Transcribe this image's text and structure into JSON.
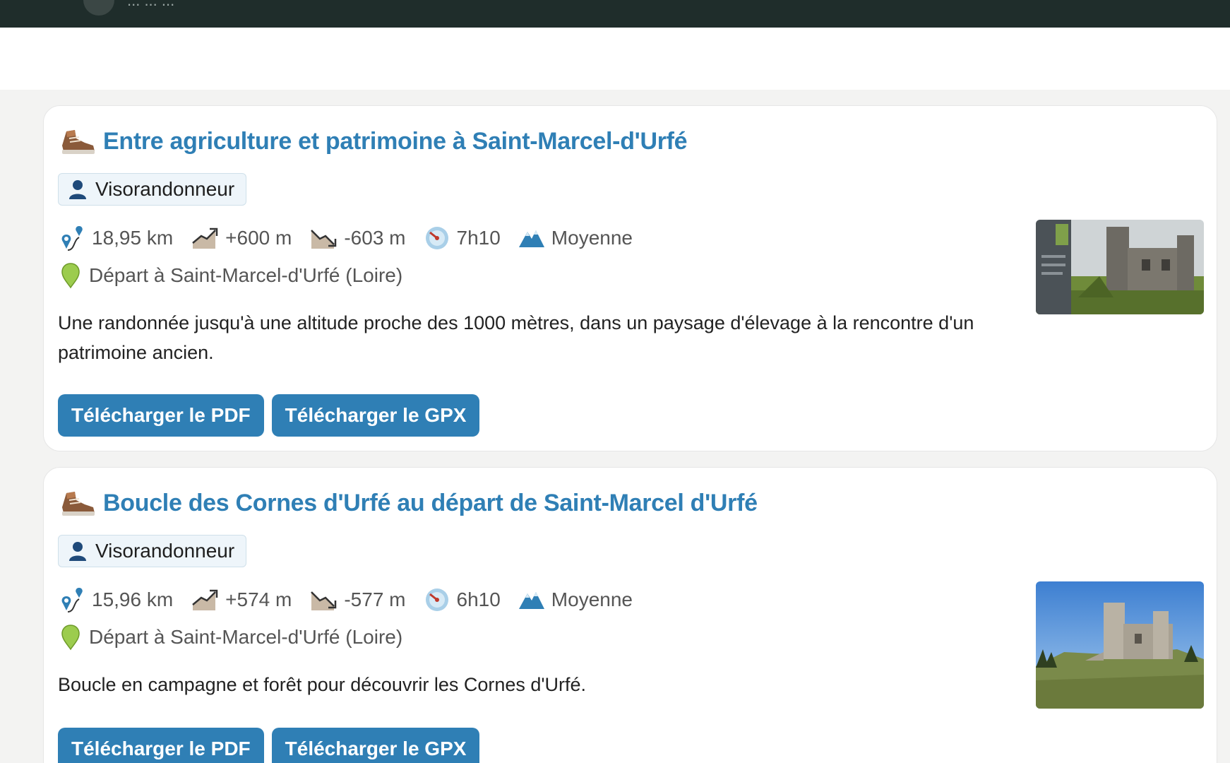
{
  "topbar": {
    "text": "...  ...  ..."
  },
  "colors": {
    "accent": "#2f7fb5",
    "topbar": "#1f2d2b",
    "page_bg": "#f3f3f2"
  },
  "hikes": [
    {
      "title": "Entre agriculture et patrimoine à Saint-Marcel-d'Urfé",
      "author": "Visorandonneur",
      "distance": "18,95 km",
      "ascent": "+600 m",
      "descent": "-603 m",
      "duration": "7h10",
      "difficulty": "Moyenne",
      "start": "Départ à Saint-Marcel-d'Urfé (Loire)",
      "description": "Une randonnée jusqu'à une altitude proche des 1000 mètres, dans un paysage d'élevage à la rencontre d'un patrimoine ancien.",
      "pdf_label": "Télécharger le PDF",
      "gpx_label": "Télécharger le GPX",
      "photo": "castle-ruins-with-sign-photo"
    },
    {
      "title": "Boucle des Cornes d'Urfé au départ de Saint-Marcel d'Urfé",
      "author": "Visorandonneur",
      "distance": "15,96 km",
      "ascent": "+574 m",
      "descent": "-577 m",
      "duration": "6h10",
      "difficulty": "Moyenne",
      "start": "Départ à Saint-Marcel-d'Urfé (Loire)",
      "description": "Boucle en campagne et forêt pour découvrir les Cornes d'Urfé.",
      "pdf_label": "Télécharger le PDF",
      "gpx_label": "Télécharger le GPX",
      "photo": "castle-on-hill-photo"
    }
  ],
  "icons": {
    "title": "hiking-boot-icon",
    "author": "person-icon",
    "distance": "route-pin-icon",
    "ascent": "ascent-icon",
    "descent": "descent-icon",
    "duration": "timer-icon",
    "difficulty": "mountain-icon",
    "start": "location-pin-icon"
  }
}
